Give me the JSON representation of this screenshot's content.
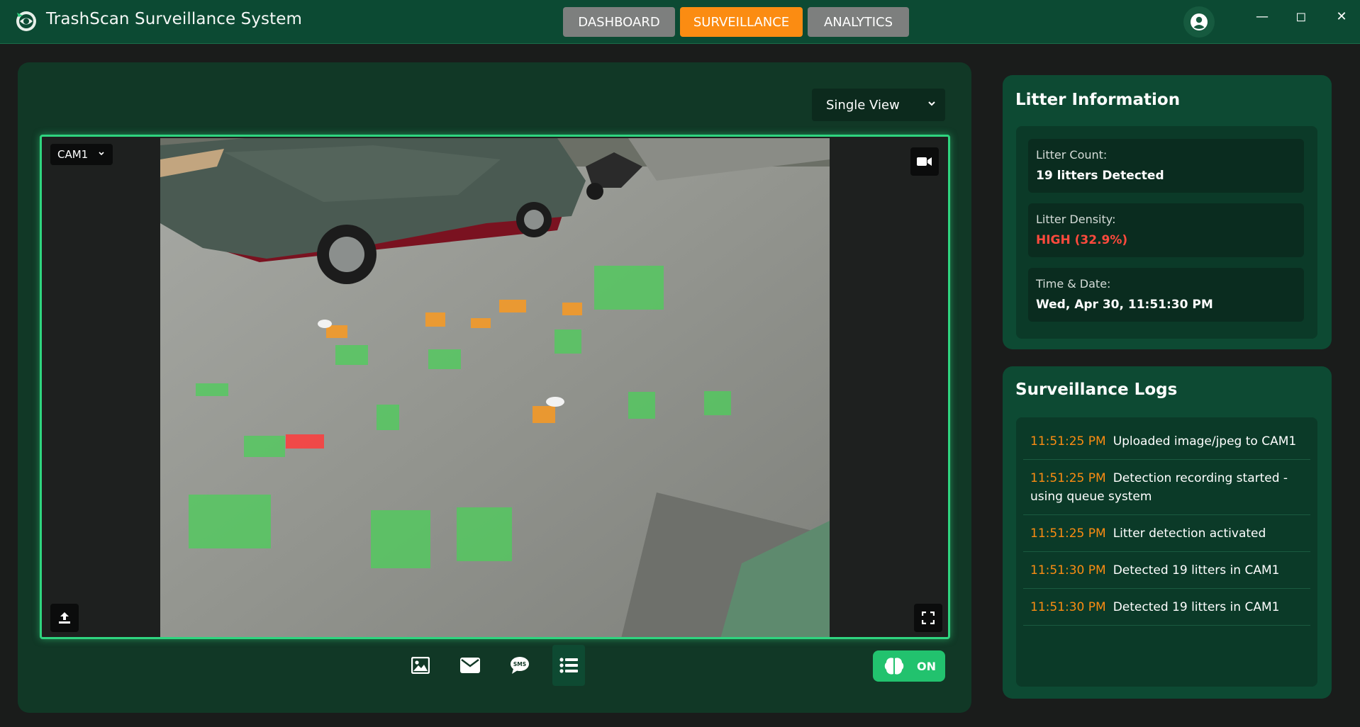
{
  "app": {
    "title": "TrashScan Surveillance System"
  },
  "nav": {
    "tabs": [
      {
        "label": "DASHBOARD",
        "active": false
      },
      {
        "label": "SURVEILLANCE",
        "active": true
      },
      {
        "label": "ANALYTICS",
        "active": false
      }
    ]
  },
  "window_controls": {
    "minimize": "—",
    "maximize": "◻",
    "close": "✕"
  },
  "camera": {
    "view_mode": "Single View",
    "camera_name": "CAM1",
    "detection_toggle": "ON",
    "detection_on": true
  },
  "toolbar": {
    "icons": [
      "image-icon",
      "mail-icon",
      "sms-icon",
      "list-icon"
    ]
  },
  "litter_info": {
    "title": "Litter Information",
    "count_label": "Litter Count:",
    "count_value": "19 litters Detected",
    "density_label": "Litter Density:",
    "density_value": "HIGH (32.9%)",
    "time_label": "Time & Date:",
    "time_value": "Wed, Apr 30, 11:51:30 PM"
  },
  "logs": {
    "title": "Surveillance Logs",
    "entries": [
      {
        "time": "11:51:25 PM",
        "message": "Uploaded image/jpeg to CAM1"
      },
      {
        "time": "11:51:25 PM",
        "message": "Detection recording started - using queue system"
      },
      {
        "time": "11:51:25 PM",
        "message": "Litter detection activated"
      },
      {
        "time": "11:51:30 PM",
        "message": "Detected 19 litters in CAM1"
      },
      {
        "time": "11:51:30 PM",
        "message": "Detected 19 litters in CAM1"
      }
    ]
  },
  "colors": {
    "accent": "#2fd47f",
    "active_tab": "#fb8c12",
    "panel": "#0d4a33",
    "high_density": "#ff4a3d",
    "detection_green": "#4ccf5a",
    "detection_orange": "#ff9a1a",
    "detection_red": "#ff3b3b"
  }
}
